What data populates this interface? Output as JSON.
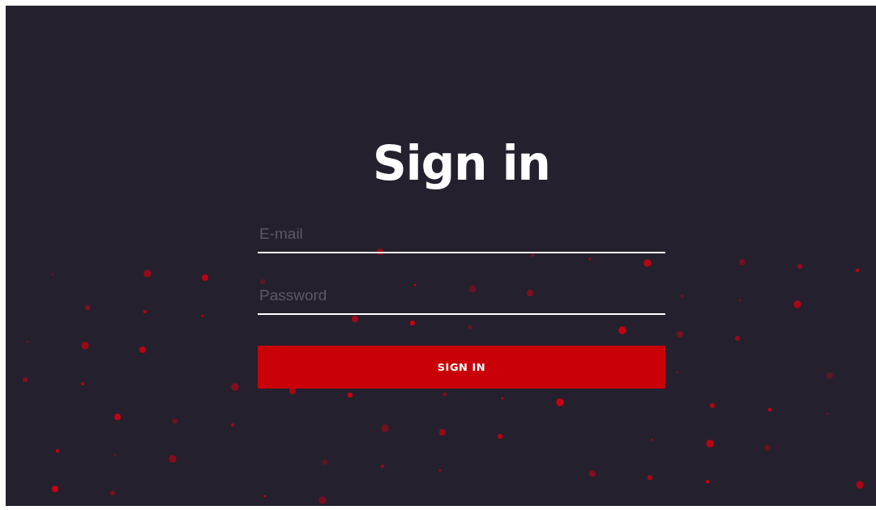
{
  "heading": "Sign in",
  "fields": [
    {
      "placeholder": "E-mail"
    },
    {
      "placeholder": "Password"
    }
  ],
  "button": "SIGN IN"
}
